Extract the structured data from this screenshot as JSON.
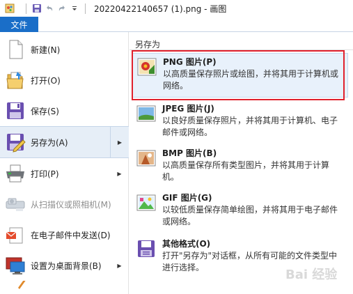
{
  "window": {
    "title": "20220422140657 (1).png - 画图"
  },
  "tabs": {
    "file_label": "文件"
  },
  "left_menu": [
    {
      "label": "新建(N)",
      "icon": "new-document-icon",
      "enabled": true,
      "has_submenu": false
    },
    {
      "label": "打开(O)",
      "icon": "open-folder-icon",
      "enabled": true,
      "has_submenu": false
    },
    {
      "label": "保存(S)",
      "icon": "floppy-disk-icon",
      "enabled": true,
      "has_submenu": false
    },
    {
      "label": "另存为(A)",
      "icon": "save-as-icon",
      "enabled": true,
      "has_submenu": true,
      "selected": true
    },
    {
      "label": "打印(P)",
      "icon": "printer-icon",
      "enabled": true,
      "has_submenu": true
    },
    {
      "label": "从扫描仪或照相机(M)",
      "icon": "scanner-icon",
      "enabled": false,
      "has_submenu": false
    },
    {
      "label": "在电子邮件中发送(D)",
      "icon": "email-icon",
      "enabled": true,
      "has_submenu": false
    },
    {
      "label": "设置为桌面背景(B)",
      "icon": "desktop-background-icon",
      "enabled": true,
      "has_submenu": true
    }
  ],
  "save_as_panel": {
    "title": "另存为",
    "items": [
      {
        "name": "PNG 图片(P)",
        "desc": "以高质量保存照片或绘图，并将其用于计算机或网络。",
        "icon": "png-image-icon",
        "highlighted": true
      },
      {
        "name": "JPEG 图片(J)",
        "desc": "以良好质量保存照片，并将其用于计算机、电子邮件或网络。",
        "icon": "jpeg-image-icon",
        "highlighted": false
      },
      {
        "name": "BMP 图片(B)",
        "desc": "以高质量保存所有类型图片，并将其用于计算机。",
        "icon": "bmp-image-icon",
        "highlighted": false
      },
      {
        "name": "GIF 图片(G)",
        "desc": "以较低质量保存简单绘图，并将其用于电子邮件或网络。",
        "icon": "gif-image-icon",
        "highlighted": false
      },
      {
        "name": "其他格式(O)",
        "desc": "打开\"另存为\"对话框，从所有可能的文件类型中进行选择。",
        "icon": "other-formats-icon",
        "highlighted": false
      }
    ]
  },
  "colors": {
    "file_tab_bg": "#1a6ec8",
    "highlight_border": "#e0202c",
    "selected_bg": "#e6eef7"
  },
  "watermark": "Bai 经验"
}
